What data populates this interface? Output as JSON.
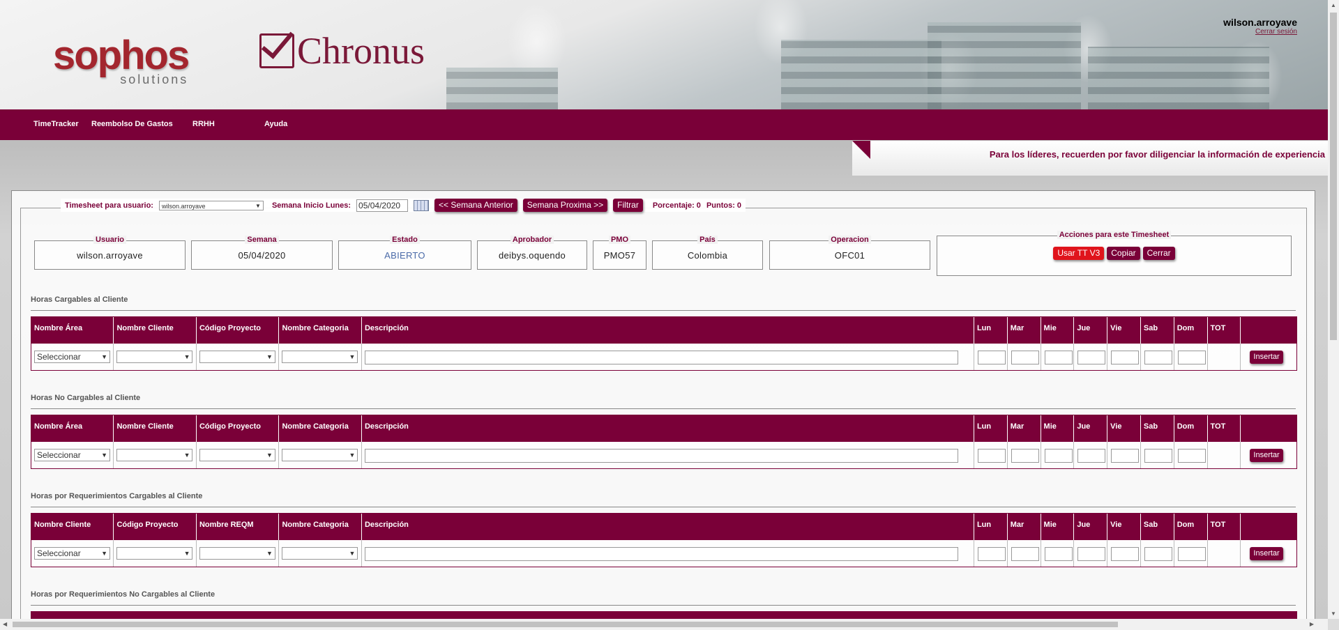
{
  "header": {
    "logo_main": "sophos",
    "logo_sub": "solutions",
    "app_logo": "Chronus",
    "user_name": "wilson.arroyave",
    "logout_label": "Cerrar sesión"
  },
  "nav": {
    "items": [
      {
        "label": "TimeTracker"
      },
      {
        "label": "Reembolso De Gastos"
      },
      {
        "label": "RRHH"
      },
      {
        "label": "Ayuda"
      }
    ]
  },
  "announcement": "Para los líderes, recuerden por favor diligenciar la información de experiencia",
  "filter": {
    "user_label": "Timesheet para usuario:",
    "user_value": "wilson.arroyave",
    "week_label": "Semana Inicio Lunes:",
    "week_value": "05/04/2020",
    "prev_week": "<< Semana Anterior",
    "next_week": "Semana Proxima >>",
    "filter_btn": "Filtrar",
    "percent_text": "Porcentaje: 0",
    "points_text": "Puntos: 0"
  },
  "info": {
    "usuario_label": "Usuario",
    "usuario": "wilson.arroyave",
    "semana_label": "Semana",
    "semana": "05/04/2020",
    "estado_label": "Estado",
    "estado": "ABIERTO",
    "aprobador_label": "Aprobador",
    "aprobador": "deibys.oquendo",
    "pmo_label": "PMO",
    "pmo": "PMO57",
    "pais_label": "País",
    "pais": "Colombia",
    "operacion_label": "Operacion",
    "operacion": "OFC01",
    "acciones_label": "Acciones para este Timesheet",
    "usar_tt": "Usar TT V3",
    "copiar": "Copiar",
    "cerrar": "Cerrar"
  },
  "sections": [
    {
      "title": "Horas Cargables al Cliente",
      "columns": [
        "Nombre Área",
        "Nombre Cliente",
        "Código Proyecto",
        "Nombre Categoria",
        "Descripción",
        "Lun",
        "Mar",
        "Mie",
        "Jue",
        "Vie",
        "Sab",
        "Dom",
        "TOT"
      ],
      "first_select": "Seleccionar",
      "insert_label": "Insertar"
    },
    {
      "title": "Horas No Cargables al Cliente",
      "columns": [
        "Nombre Área",
        "Nombre Cliente",
        "Código Proyecto",
        "Nombre Categoria",
        "Descripción",
        "Lun",
        "Mar",
        "Mie",
        "Jue",
        "Vie",
        "Sab",
        "Dom",
        "TOT"
      ],
      "first_select": "Seleccionar",
      "insert_label": "Insertar"
    },
    {
      "title": "Horas por Requerimientos Cargables al Cliente",
      "columns": [
        "Nombre Cliente",
        "Código Proyecto",
        "Nombre REQM",
        "Nombre Categoria",
        "Descripción",
        "Lun",
        "Mar",
        "Mie",
        "Jue",
        "Vie",
        "Sab",
        "Dom",
        "TOT"
      ],
      "first_select": "Seleccionar",
      "insert_label": "Insertar"
    },
    {
      "title": "Horas por Requerimientos No Cargables al Cliente"
    }
  ],
  "colors": {
    "brand": "#7a0038",
    "accent_red": "#e0141c"
  }
}
